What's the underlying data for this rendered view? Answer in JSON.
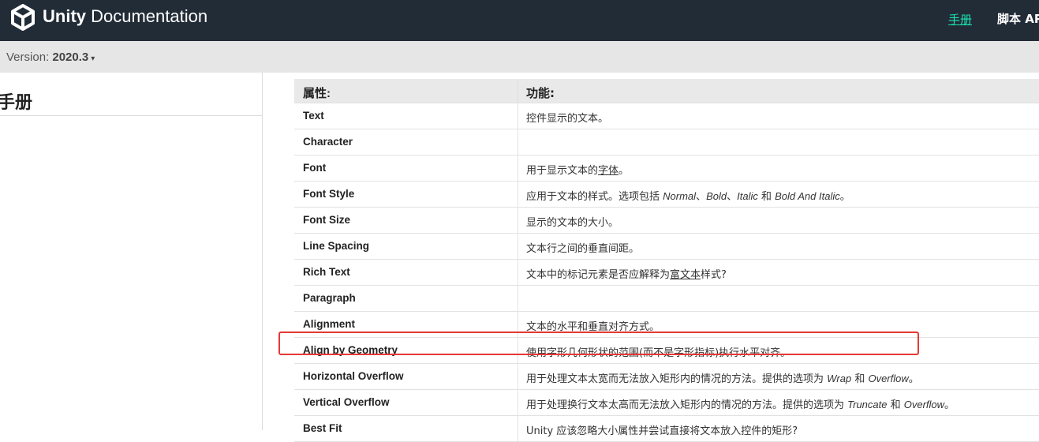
{
  "header": {
    "brand_bold": "Unity",
    "brand_rest": " Documentation",
    "nav_manual": "手册",
    "nav_script": "脚本 AP",
    "logo_icon": "unity-logo-icon",
    "accent_color": "#19e3b1",
    "bg_color": "#222c37"
  },
  "versionbar": {
    "label": "Version: ",
    "value": "2020.3",
    "caret": "▾"
  },
  "sidebar": {
    "title": "手册"
  },
  "table": {
    "headers": {
      "property": "属性:",
      "function": "功能:"
    },
    "rows": [
      {
        "property": "Text",
        "desc": [
          {
            "t": "控件显示的文本。"
          }
        ]
      },
      {
        "property": "Character",
        "desc": []
      },
      {
        "property": "Font",
        "desc": [
          {
            "t": "用于显示文本的"
          },
          {
            "t": "字体",
            "u": true
          },
          {
            "t": "。"
          }
        ]
      },
      {
        "property": "Font Style",
        "desc": [
          {
            "t": "应用于文本的样式。选项包括 "
          },
          {
            "t": "Normal",
            "i": true
          },
          {
            "t": "、"
          },
          {
            "t": "Bold",
            "i": true
          },
          {
            "t": "、"
          },
          {
            "t": "Italic",
            "i": true
          },
          {
            "t": " 和 "
          },
          {
            "t": "Bold And Italic",
            "i": true
          },
          {
            "t": "。"
          }
        ]
      },
      {
        "property": "Font Size",
        "desc": [
          {
            "t": "显示的文本的大小。"
          }
        ]
      },
      {
        "property": "Line Spacing",
        "desc": [
          {
            "t": "文本行之间的垂直间距。"
          }
        ]
      },
      {
        "property": "Rich Text",
        "desc": [
          {
            "t": "文本中的标记元素是否应解释为"
          },
          {
            "t": "富文本",
            "u": true
          },
          {
            "t": "样式?"
          }
        ]
      },
      {
        "property": "Paragraph",
        "desc": []
      },
      {
        "property": "Alignment",
        "desc": [
          {
            "t": "文本的水平和垂直对齐方式。"
          }
        ]
      },
      {
        "property": "Align by Geometry",
        "desc": [
          {
            "t": "使用字形几何形状的范围(而不是字形指标)执行水平对齐。"
          }
        ]
      },
      {
        "property": "Horizontal Overflow",
        "desc": [
          {
            "t": "用于处理文本太宽而无法放入矩形内的情况的方法。提供的选项为 "
          },
          {
            "t": "Wrap",
            "i": true
          },
          {
            "t": " 和 "
          },
          {
            "t": "Overflow",
            "i": true
          },
          {
            "t": "。"
          }
        ]
      },
      {
        "property": "Vertical Overflow",
        "desc": [
          {
            "t": "用于处理换行文本太高而无法放入矩形内的情况的方法。提供的选项为 "
          },
          {
            "t": "Truncate",
            "i": true
          },
          {
            "t": " 和 "
          },
          {
            "t": "Overflow",
            "i": true
          },
          {
            "t": "。"
          }
        ]
      },
      {
        "property": "Best Fit",
        "desc": [
          {
            "t": "Unity 应该忽略大小属性并尝试直接将文本放入控件的矩形?"
          }
        ]
      }
    ]
  },
  "annotation": {
    "highlight_color": "#e53935",
    "highlighted_row": "Align by Geometry"
  }
}
